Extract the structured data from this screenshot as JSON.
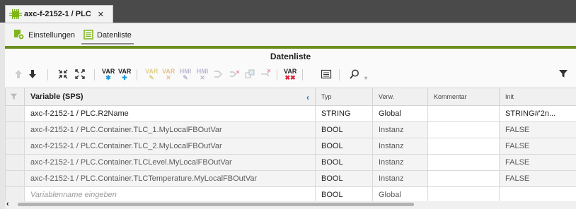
{
  "document_tab": {
    "title": "axc-f-2152-1 / PLC",
    "close": "✕"
  },
  "subtabs": [
    {
      "label": "Einstellungen",
      "icon": "settings-gear-icon"
    },
    {
      "label": "Datenliste",
      "icon": "list-icon"
    }
  ],
  "panel": {
    "title": "Datenliste"
  },
  "toolbar": {
    "var_label": "VAR",
    "hmi_label": "HMI"
  },
  "table": {
    "columns": [
      "Variable (SPS)",
      "Typ",
      "Verw.",
      "Kommentar",
      "Init"
    ],
    "rows": [
      {
        "prefix": "axc-f-2152-1 / PLC.",
        "name": "R2Name",
        "type": "STRING",
        "usage": "Global",
        "comment": "",
        "init": "STRING#'2n..."
      },
      {
        "prefix": "axc-f-2152-1 / PLC.",
        "name": "Container.TLC_1.MyLocalFBOutVar",
        "type": "BOOL",
        "usage": "Instanz",
        "comment": "",
        "init": "FALSE"
      },
      {
        "prefix": "axc-f-2152-1 / PLC.",
        "name": "Container.TLC_2.MyLocalFBOutVar",
        "type": "BOOL",
        "usage": "Instanz",
        "comment": "",
        "init": "FALSE"
      },
      {
        "prefix": "axc-f-2152-1 / PLC.",
        "name": "Container.TLCLevel.MyLocalFBOutVar",
        "type": "BOOL",
        "usage": "Instanz",
        "comment": "",
        "init": "FALSE"
      },
      {
        "prefix": "axc-f-2152-1 / PLC.",
        "name": "Container.TLCTemperature.MyLocalFBOutVar",
        "type": "BOOL",
        "usage": "Instanz",
        "comment": "",
        "init": "FALSE"
      }
    ],
    "new_row": {
      "placeholder": "Variablenname eingeben",
      "type": "BOOL",
      "usage": "Global"
    }
  },
  "colors": {
    "accent_green": "#6a8f1e",
    "titlebar": "#4a4a4a",
    "link_blue": "#1f78b4"
  }
}
